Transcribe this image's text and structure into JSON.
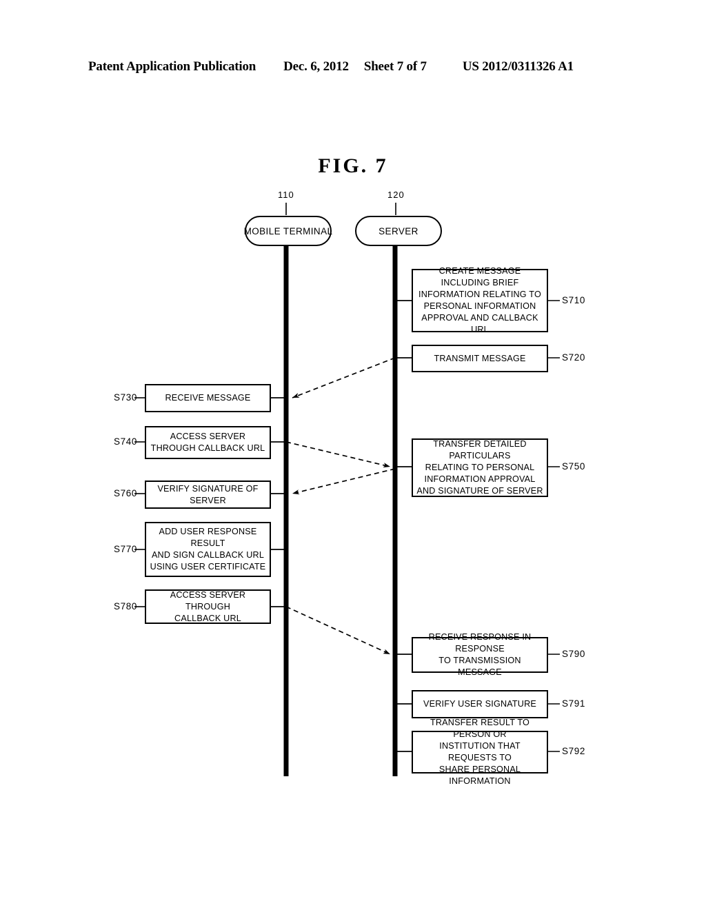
{
  "header": {
    "publication": "Patent Application Publication",
    "date": "Dec. 6, 2012",
    "sheet": "Sheet 7 of 7",
    "number": "US 2012/0311326 A1"
  },
  "figure": {
    "title": "FIG.  7"
  },
  "actors": [
    {
      "id": "mobile-terminal",
      "label": "MOBILE TERMINAL",
      "ref": "110"
    },
    {
      "id": "server",
      "label": "SERVER",
      "ref": "120"
    }
  ],
  "steps": {
    "s710": {
      "id": "S710",
      "side": "server",
      "lines": [
        "CREATE MESSAGE INCLUDING BRIEF",
        "INFORMATION RELATING TO",
        "PERSONAL INFORMATION",
        "APPROVAL AND CALLBACK URL"
      ]
    },
    "s720": {
      "id": "S720",
      "side": "server",
      "lines": [
        "TRANSMIT MESSAGE"
      ]
    },
    "s730": {
      "id": "S730",
      "side": "mobile",
      "lines": [
        "RECEIVE MESSAGE"
      ]
    },
    "s740": {
      "id": "S740",
      "side": "mobile",
      "lines": [
        "ACCESS SERVER",
        "THROUGH CALLBACK URL"
      ]
    },
    "s750": {
      "id": "S750",
      "side": "server",
      "lines": [
        "TRANSFER DETAILED PARTICULARS",
        "RELATING TO PERSONAL",
        "INFORMATION APPROVAL",
        "AND SIGNATURE OF SERVER"
      ]
    },
    "s760": {
      "id": "S760",
      "side": "mobile",
      "lines": [
        "VERIFY SIGNATURE OF SERVER"
      ]
    },
    "s770": {
      "id": "S770",
      "side": "mobile",
      "lines": [
        "ADD USER RESPONSE RESULT",
        "AND SIGN CALLBACK URL",
        "USING USER CERTIFICATE"
      ]
    },
    "s780": {
      "id": "S780",
      "side": "mobile",
      "lines": [
        "ACCESS SERVER THROUGH",
        "CALLBACK URL"
      ]
    },
    "s790": {
      "id": "S790",
      "side": "server",
      "lines": [
        "RECEIVE RESPONSE IN RESPONSE",
        "TO TRANSMISSION MESSAGE"
      ]
    },
    "s791": {
      "id": "S791",
      "side": "server",
      "lines": [
        "VERIFY USER SIGNATURE"
      ]
    },
    "s792": {
      "id": "S792",
      "side": "server",
      "lines": [
        "TRANSFER RESULT TO PERSON OR",
        "INSTITUTION THAT REQUESTS TO",
        "SHARE PERSONAL INFORMATION"
      ]
    }
  },
  "colors": {
    "ink": "#000000",
    "paper": "#ffffff"
  }
}
